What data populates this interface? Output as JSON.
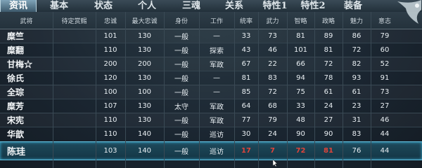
{
  "tabs": [
    "资讯",
    "基本",
    "状态",
    "个人",
    "三魂",
    "关系",
    "特性1",
    "特性2",
    "装备"
  ],
  "active_tab": 0,
  "headers": [
    "武将",
    "待定赏赐",
    "忠诚",
    "最大忠诚",
    "身份",
    "工作",
    "统率",
    "武力",
    "智略",
    "政略",
    "魅力",
    "意志"
  ],
  "rows": [
    [
      "糜竺",
      "",
      "101",
      "130",
      "一般",
      "—",
      "33",
      "73",
      "81",
      "89",
      "86",
      "79"
    ],
    [
      "糜翻",
      "",
      "110",
      "130",
      "一般",
      "探索",
      "43",
      "46",
      "101",
      "81",
      "72",
      "60"
    ],
    [
      "甘梅☆",
      "",
      "200",
      "200",
      "一般",
      "军政",
      "67",
      "22",
      "66",
      "72",
      "82",
      "52"
    ],
    [
      "徐氏",
      "",
      "120",
      "130",
      "一般",
      "—",
      "81",
      "83",
      "94",
      "78",
      "93",
      "91"
    ],
    [
      "全琮",
      "",
      "100",
      "100",
      "一般",
      "—",
      "85",
      "72",
      "75",
      "61",
      "61",
      "73"
    ],
    [
      "糜芳",
      "",
      "107",
      "130",
      "太守",
      "军政",
      "64",
      "68",
      "33",
      "24",
      "23",
      "27"
    ],
    [
      "宋宪",
      "",
      "110",
      "130",
      "一般",
      "军政",
      "77",
      "79",
      "48",
      "27",
      "31",
      "46"
    ],
    [
      "华歆",
      "",
      "110",
      "140",
      "一般",
      "巡访",
      "30",
      "24",
      "90",
      "90",
      "83",
      "44"
    ],
    [
      "陈珪",
      "",
      "103",
      "140",
      "一般",
      "巡访",
      "17",
      "7",
      "72",
      "81",
      "76",
      "44"
    ]
  ],
  "selected_row": 8,
  "selected_red_columns": [
    6,
    7,
    8,
    9
  ],
  "colors": {
    "accent": "#64c6e6",
    "low_stat": "#e0443a",
    "background": "#1b2731"
  }
}
